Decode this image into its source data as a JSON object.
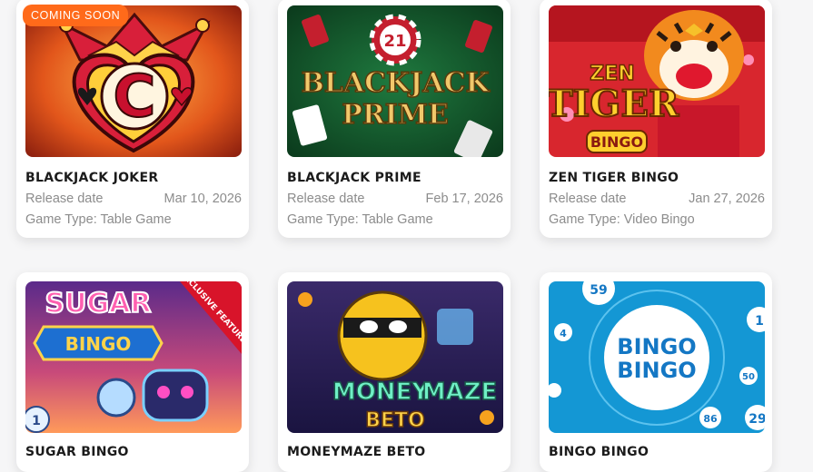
{
  "games": [
    {
      "title": "BLACKJACK JOKER",
      "release_label": "Release date",
      "release_date": "Mar 10, 2026",
      "type": "Game Type: Table Game",
      "badge": "COMING SOON",
      "art_text": "C"
    },
    {
      "title": "BLACKJACK PRIME",
      "release_label": "Release date",
      "release_date": "Feb 17, 2026",
      "type": "Game Type: Table Game",
      "art_text": "BLACKJACK",
      "art_text2": "PRIME",
      "chip": "21"
    },
    {
      "title": "ZEN TIGER BINGO",
      "release_label": "Release date",
      "release_date": "Jan 27, 2026",
      "type": "Game Type: Video Bingo",
      "art_text": "ZEN",
      "art_text2": "TIGER",
      "art_text3": "BINGO"
    },
    {
      "title": "SUGAR BINGO",
      "art_text": "SUGAR",
      "art_text2": "BINGO",
      "ribbon": "EXCLUSIVE FEATURE"
    },
    {
      "title": "MONEYMAZE BETO",
      "art_text": "MONEY",
      "art_text2": "MAZE",
      "art_text3": "BETO"
    },
    {
      "title": "BINGO BINGO",
      "art_text": "BINGO",
      "art_text2": "BINGO",
      "balls": [
        "59",
        "4",
        "1",
        "50",
        "86",
        "29"
      ]
    }
  ],
  "colors": {
    "badge": "#ff6a1a",
    "title": "#1b1b1b",
    "meta": "#8c8c8c"
  }
}
